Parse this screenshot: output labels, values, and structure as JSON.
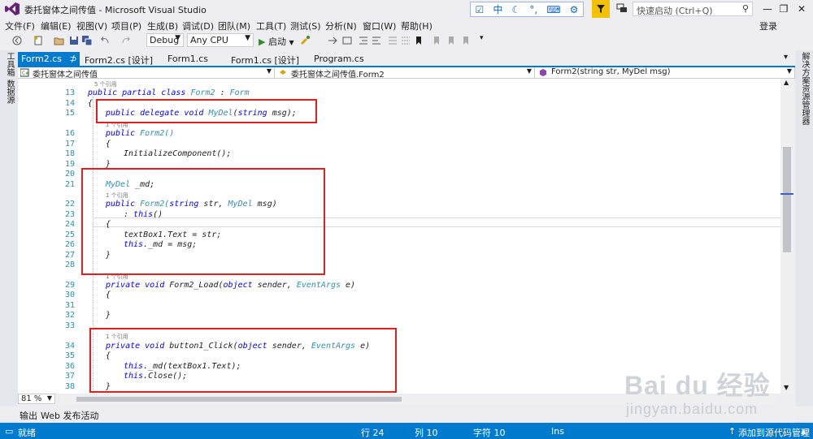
{
  "window": {
    "title": "委托窗体之间传值 - Microsoft Visual Studio",
    "quick_launch_placeholder": "快速启动 (Ctrl+Q)",
    "ime_char": "中",
    "login": "登录"
  },
  "menu": [
    "文件(F)",
    "编辑(E)",
    "视图(V)",
    "项目(P)",
    "生成(B)",
    "调试(D)",
    "团队(M)",
    "工具(T)",
    "测试(S)",
    "分析(N)",
    "窗口(W)",
    "帮助(H)"
  ],
  "toolbar": {
    "config": "Debug",
    "platform": "Any CPU",
    "start_label": "启动"
  },
  "left_tool_windows": [
    "工具箱",
    "数据源"
  ],
  "right_tool_windows": [
    "解决方案资源管理器"
  ],
  "tabs": [
    "Form2.cs",
    "Form2.cs [设计]",
    "Form1.cs",
    "Form1.cs [设计]",
    "Program.cs"
  ],
  "tab_pin": "⊅",
  "tab_close": "×",
  "nav": {
    "project": "委托窗体之间传值",
    "type": "委托窗体之间传值.Form2",
    "member": "Form2(string str, MyDel msg)"
  },
  "code_lines": [
    {
      "n": "",
      "refs": "5 个引用",
      "text": ""
    },
    {
      "n": "13",
      "text": ""
    },
    {
      "n": "14",
      "text": "{"
    },
    {
      "n": "15",
      "text": ""
    },
    {
      "n": "",
      "refs": "1 个引用",
      "text": ""
    },
    {
      "n": "16",
      "text": ""
    },
    {
      "n": "17",
      "text": "{"
    },
    {
      "n": "18",
      "text": "InitializeComponent();"
    },
    {
      "n": "19",
      "text": "}"
    },
    {
      "n": "20",
      "text": ""
    },
    {
      "n": "21",
      "text": ""
    },
    {
      "n": "",
      "refs": "1 个引用",
      "text": ""
    },
    {
      "n": "22",
      "text": ""
    },
    {
      "n": "23",
      "text": ""
    },
    {
      "n": "24",
      "text": "{"
    },
    {
      "n": "25",
      "text": "textBox1.Text = str;"
    },
    {
      "n": "26",
      "text": ""
    },
    {
      "n": "27",
      "text": "}"
    },
    {
      "n": "28",
      "text": ""
    },
    {
      "n": "",
      "refs": "1 个引用",
      "text": ""
    },
    {
      "n": "29",
      "text": ""
    },
    {
      "n": "30",
      "text": "{"
    },
    {
      "n": "31",
      "text": ""
    },
    {
      "n": "32",
      "text": "}"
    },
    {
      "n": "33",
      "text": ""
    },
    {
      "n": "",
      "refs": "1 个引用",
      "text": ""
    },
    {
      "n": "34",
      "text": ""
    },
    {
      "n": "35",
      "text": "{"
    },
    {
      "n": "36",
      "text": ""
    },
    {
      "n": "37",
      "text": ""
    },
    {
      "n": "38",
      "text": "}"
    }
  ],
  "code_tokens": {
    "l13": [
      "public partial class ",
      "Form2",
      " : ",
      "Form"
    ],
    "l15": [
      "public delegate void ",
      "MyDel",
      "(",
      "string",
      " msg);"
    ],
    "l16": [
      "public ",
      "Form2()"
    ],
    "l21": [
      "MyDel",
      " _md;"
    ],
    "l22": [
      "public ",
      "Form2(",
      "string",
      " str, ",
      "MyDel",
      " msg)"
    ],
    "l23": [
      ": ",
      "this",
      "()"
    ],
    "l26": [
      "this",
      "._md = msg;"
    ],
    "l29": [
      "private void ",
      "Form2_Load(",
      "object",
      " sender, ",
      "EventArgs",
      " e)"
    ],
    "l34": [
      "private void ",
      "button1_Click(",
      "object",
      " sender, ",
      "EventArgs",
      " e)"
    ],
    "l36": [
      "this",
      "._md(textBox1.Text);"
    ],
    "l37": [
      "this",
      ".Close();"
    ]
  },
  "zoom": "81 %",
  "bottom_tabs": [
    "输出",
    "Web 发布活动"
  ],
  "status": {
    "ready": "就绪",
    "row": "行 24",
    "col": "列 10",
    "char": "字符 10",
    "mode": "Ins",
    "source_control": "添加到源代码管理"
  },
  "watermark": {
    "logo": "Bai du 经验",
    "url": "jingyan.baidu.com"
  },
  "colors": {
    "accent": "#007acc",
    "keyword": "#0000ff",
    "type": "#2b91af",
    "highlight_box": "#e02020"
  }
}
